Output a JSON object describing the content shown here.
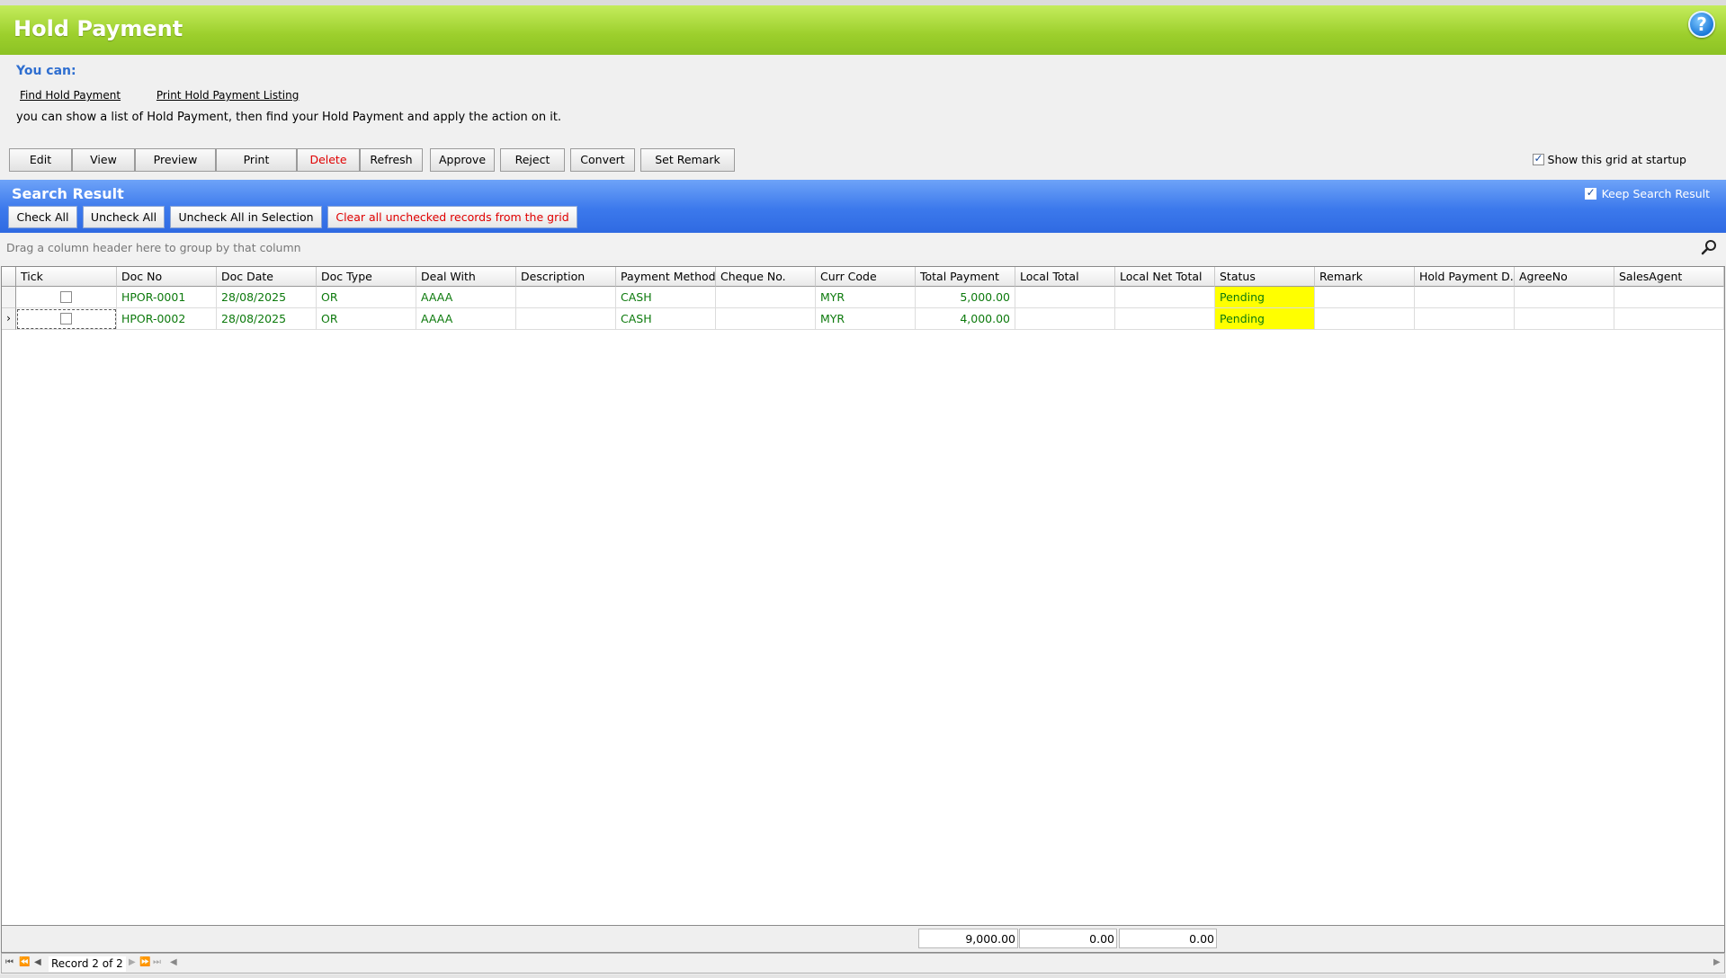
{
  "app": {
    "title": "Hold Payment",
    "help_glyph": "?"
  },
  "intro": {
    "you_can": "You can:",
    "links": [
      "Find Hold Payment",
      "Print Hold Payment Listing"
    ],
    "description": "you can show a list of Hold Payment, then find your Hold Payment and apply the action on it."
  },
  "toolbar": {
    "buttons": [
      "Edit",
      "View",
      "Preview",
      "Print",
      "Delete",
      "Refresh",
      "Approve",
      "Reject",
      "Convert",
      "Set Remark"
    ],
    "show_grid_label": "Show this grid at startup",
    "show_grid_checked": true
  },
  "search_result": {
    "title": "Search Result",
    "keep_label": "Keep Search Result",
    "keep_checked": true,
    "buttons": [
      "Check All",
      "Uncheck All",
      "Uncheck All in Selection",
      "Clear all unchecked records from the grid"
    ]
  },
  "group_panel": {
    "hint": "Drag a column header here to group by that column"
  },
  "grid": {
    "columns": [
      "Tick",
      "Doc No",
      "Doc Date",
      "Doc Type",
      "Deal With",
      "Description",
      "Payment Method",
      "Cheque No.",
      "Curr Code",
      "Total Payment",
      "Local Total",
      "Local Net Total",
      "Status",
      "Remark",
      "Hold Payment D...",
      "AgreeNo",
      "SalesAgent"
    ],
    "rows": [
      {
        "tick": false,
        "doc_no": "HPOR-0001",
        "doc_date": "28/08/2025",
        "doc_type": "OR",
        "deal_with": "AAAA",
        "description": "",
        "payment_method": "CASH",
        "cheque_no": "",
        "curr_code": "MYR",
        "total_payment": "5,000.00",
        "local_total": "",
        "local_net_total": "",
        "status": "Pending",
        "remark": "",
        "hold_payment_d": "",
        "agree_no": "",
        "sales_agent": ""
      },
      {
        "tick": false,
        "doc_no": "HPOR-0002",
        "doc_date": "28/08/2025",
        "doc_type": "OR",
        "deal_with": "AAAA",
        "description": "",
        "payment_method": "CASH",
        "cheque_no": "",
        "curr_code": "MYR",
        "total_payment": "4,000.00",
        "local_total": "",
        "local_net_total": "",
        "status": "Pending",
        "remark": "",
        "hold_payment_d": "",
        "agree_no": "",
        "sales_agent": ""
      }
    ],
    "current_row_glyph": "›",
    "totals": {
      "total_payment": "9,000.00",
      "local_total": "0.00",
      "local_net_total": "0.00"
    }
  },
  "navigator": {
    "record_info": "Record 2 of 2"
  },
  "colors": {
    "title_green": "#9ccf2c",
    "band_blue": "#3c79ec",
    "row_text_green": "#0d7a0d",
    "status_yellow": "#ffff00",
    "delete_red": "#e00000"
  }
}
